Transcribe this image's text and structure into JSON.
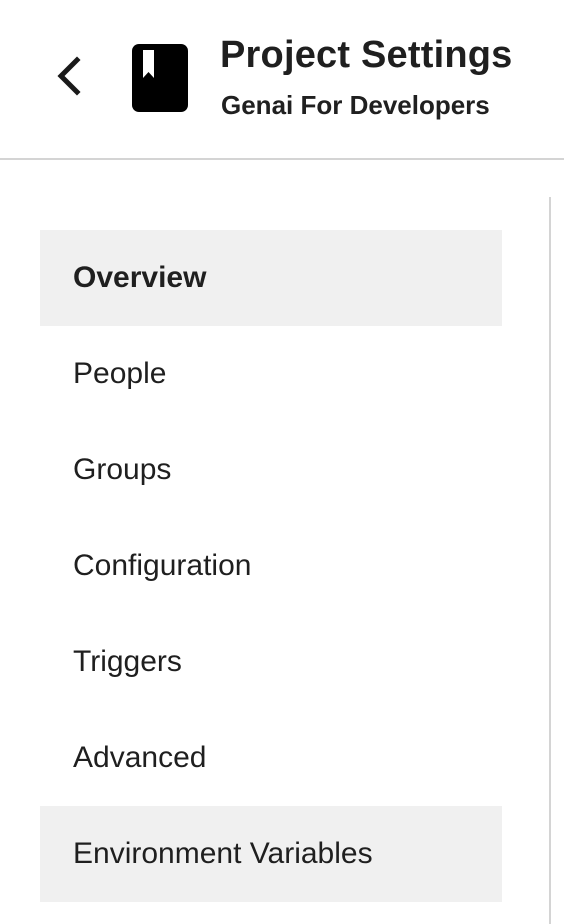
{
  "header": {
    "back_icon": "chevron-left-icon",
    "project_icon": "bookmark-book-icon",
    "title": "Project Settings",
    "subtitle": "Genai For Developers"
  },
  "sidebar": {
    "items": [
      {
        "label": "Overview",
        "state": "selected"
      },
      {
        "label": "People",
        "state": "normal"
      },
      {
        "label": "Groups",
        "state": "normal"
      },
      {
        "label": "Configuration",
        "state": "normal"
      },
      {
        "label": "Triggers",
        "state": "normal"
      },
      {
        "label": "Advanced",
        "state": "normal"
      },
      {
        "label": "Environment Variables",
        "state": "hovered"
      }
    ]
  },
  "colors": {
    "selected_bg": "#f0f0f0",
    "divider": "#d4d4d4",
    "text": "#1f1f1f"
  }
}
